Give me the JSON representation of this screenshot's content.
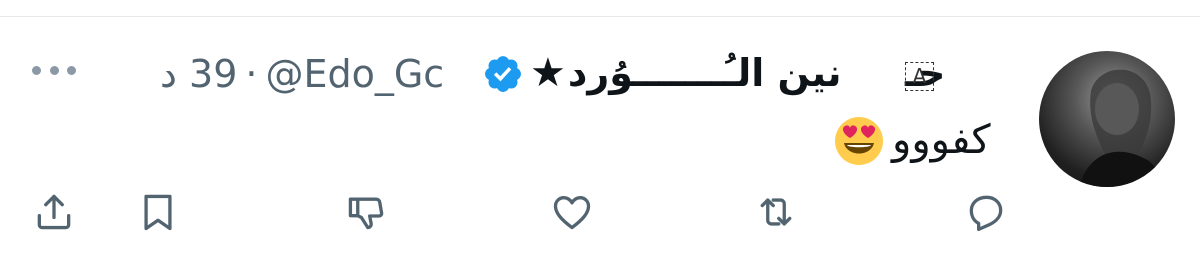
{
  "tweet": {
    "display_name_prefix": "حـ",
    "glyph_placeholder": "A",
    "display_name": "نين الـُـــــــوُرد",
    "display_name_star": "★",
    "handle": "@Edo_Gc",
    "separator": "·",
    "time_ago": "39 د",
    "text": "كفووو",
    "emoji": "smiling-face-with-heart-eyes"
  },
  "icons": {
    "more": "more-horizontal-icon",
    "verified": "verified-badge-icon",
    "reply": "reply-icon",
    "retweet": "retweet-icon",
    "like": "heart-icon",
    "dislike": "thumbs-down-icon",
    "bookmark": "bookmark-icon",
    "share": "share-icon"
  },
  "colors": {
    "text": "#0f1419",
    "secondary": "#536471",
    "icon": "#536471",
    "verified": "#1d9bf0",
    "divider": "#e6e9ec"
  }
}
